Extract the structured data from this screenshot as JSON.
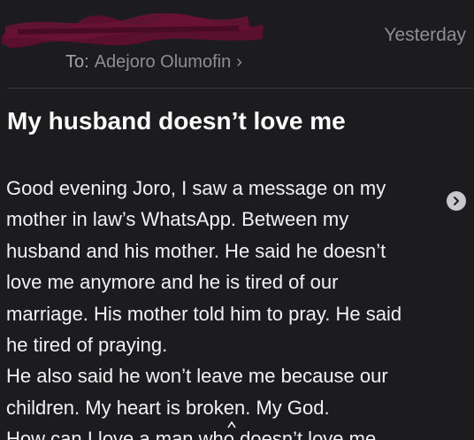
{
  "header": {
    "date": "Yesterday",
    "to_prefix": "To:",
    "recipient": "Adejoro Olumofin",
    "chevron": "›"
  },
  "subject": "My husband doesn’t love me",
  "body": {
    "lines": [
      "Good evening Joro, I saw a message on my",
      "mother in law’s WhatsApp. Between my",
      "husband and his mother. He said he doesn’t",
      "love me anymore and he is tired of our",
      "marriage.  His mother told him to pray. He said",
      "he tired of praying.",
      "He also said he won’t leave me because our",
      "children. My heart is broken. My God.",
      "How can I love a man who doesn’t love me"
    ]
  },
  "icons": {
    "expand": "chevron-right-circle-icon"
  },
  "colors": {
    "background": "#1c1c1e",
    "secondary_text": "#8e8e93",
    "redaction": "#5a0f2e"
  }
}
